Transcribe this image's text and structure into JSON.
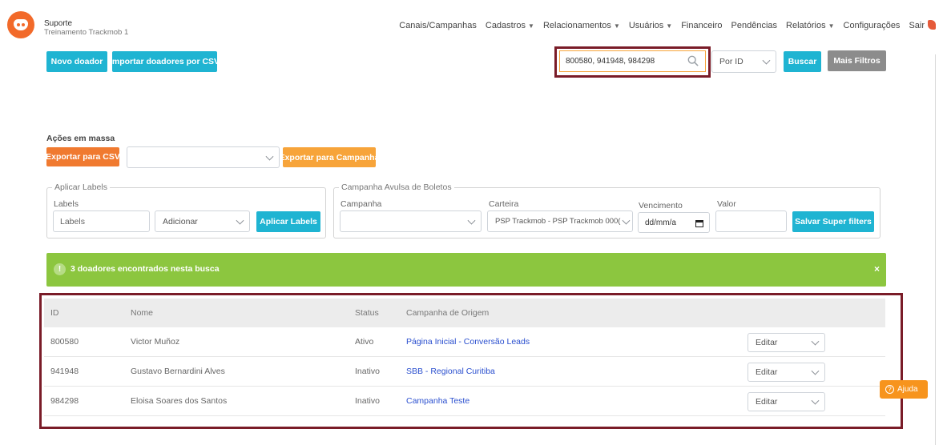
{
  "org": {
    "name": "Suporte",
    "account": "Treinamento Trackmob 1"
  },
  "nav": {
    "items": [
      {
        "label": "Canais/Campanhas",
        "dropdown": false
      },
      {
        "label": "Cadastros",
        "dropdown": true
      },
      {
        "label": "Relacionamentos",
        "dropdown": true
      },
      {
        "label": "Usuários",
        "dropdown": true
      },
      {
        "label": "Financeiro",
        "dropdown": false
      },
      {
        "label": "Pendências",
        "dropdown": false
      },
      {
        "label": "Relatórios",
        "dropdown": true
      },
      {
        "label": "Configurações",
        "dropdown": false
      },
      {
        "label": "Sair",
        "dropdown": false
      }
    ]
  },
  "toolbar": {
    "new_donor": "Novo doador",
    "import_csv": "Importar doadores por CSV",
    "search_value": "800580, 941948, 984298",
    "search_by": "Por ID",
    "search_button": "Buscar",
    "more_filters": "Mais Filtros"
  },
  "bulk": {
    "title": "Ações em massa",
    "export_csv": "Exportar para CSV",
    "action_select": "",
    "export_campaign": "Exportar para Campanha"
  },
  "labels_panel": {
    "legend": "Aplicar Labels",
    "field_label": "Labels",
    "input_placeholder": "Labels",
    "mode_select": "Adicionar",
    "apply_button": "Aplicar Labels"
  },
  "boleto_panel": {
    "legend": "Campanha Avulsa de Boletos",
    "campaign_label": "Campanha",
    "campaign_value": "",
    "wallet_label": "Carteira",
    "wallet_value": "PSP Trackmob - PSP Trackmob 000(",
    "due_label": "Vencimento",
    "due_placeholder": "dd/mm/a",
    "value_label": "Valor",
    "save_button": "Salvar Super filters"
  },
  "alert": {
    "icon": "!",
    "message": "3 doadores encontrados nesta busca",
    "close": "×"
  },
  "table": {
    "headers": {
      "id": "ID",
      "name": "Nome",
      "status": "Status",
      "campaign": "Campanha de Origem"
    },
    "rows": [
      {
        "id": "800580",
        "name": "Victor Muñoz",
        "status": "Ativo",
        "campaign": "Página Inicial - Conversão Leads",
        "action": "Editar"
      },
      {
        "id": "941948",
        "name": "Gustavo Bernardini Alves",
        "status": "Inativo",
        "campaign": "SBB - Regional Curitiba",
        "action": "Editar"
      },
      {
        "id": "984298",
        "name": "Eloisa Soares dos Santos",
        "status": "Inativo",
        "campaign": "Campanha Teste",
        "action": "Editar"
      }
    ]
  },
  "help": {
    "label": "Ajuda"
  },
  "colors": {
    "teal": "#1fb4d2",
    "orange": "#f07a30",
    "amber": "#f7a43a",
    "success": "#8cc63f",
    "highlight": "#7a1c28",
    "link": "#2a4fcf"
  }
}
